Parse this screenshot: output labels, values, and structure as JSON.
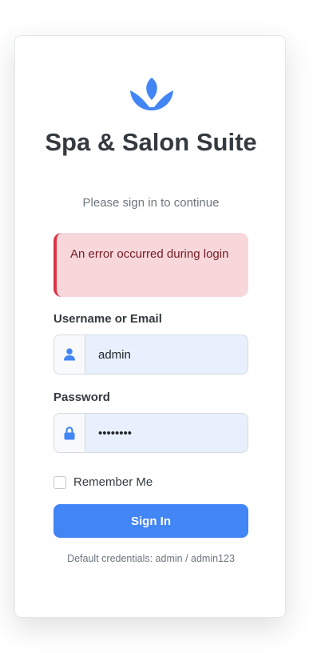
{
  "login": {
    "logo_icon": "lotus-icon",
    "title": "Spa & Salon Suite",
    "subtitle": "Please sign in to continue",
    "error_message": "An error occurred during login",
    "username_label": "Username or Email",
    "username_icon": "user-icon",
    "username_value": "admin",
    "password_label": "Password",
    "password_icon": "lock-icon",
    "password_value": "admin123",
    "remember_label": "Remember Me",
    "remember_checked": false,
    "signin_label": "Sign In",
    "credentials_hint": "Default credentials: admin / admin123",
    "colors": {
      "accent": "#4285f4",
      "error_bg": "#f8d7da",
      "error_border": "#dc3545",
      "error_text": "#721c24"
    }
  }
}
